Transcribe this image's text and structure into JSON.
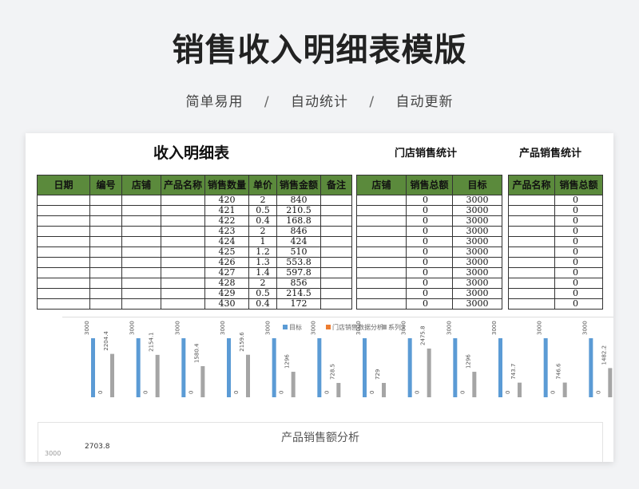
{
  "header": {
    "title": "销售收入明细表模版",
    "subtitle_items": [
      "简单易用",
      "自动统计",
      "自动更新"
    ],
    "separator": "/"
  },
  "sheet": {
    "main_title": "收入明细表",
    "store_title": "门店销售统计",
    "product_title": "产品销售统计",
    "main_table": {
      "headers": [
        "日期",
        "编号",
        "店铺",
        "产品名称",
        "销售数量",
        "单价",
        "销售金额",
        "备注"
      ],
      "rows": [
        [
          "",
          "",
          "",
          "",
          "420",
          "2",
          "840",
          ""
        ],
        [
          "",
          "",
          "",
          "",
          "421",
          "0.5",
          "210.5",
          ""
        ],
        [
          "",
          "",
          "",
          "",
          "422",
          "0.4",
          "168.8",
          ""
        ],
        [
          "",
          "",
          "",
          "",
          "423",
          "2",
          "846",
          ""
        ],
        [
          "",
          "",
          "",
          "",
          "424",
          "1",
          "424",
          ""
        ],
        [
          "",
          "",
          "",
          "",
          "425",
          "1.2",
          "510",
          ""
        ],
        [
          "",
          "",
          "",
          "",
          "426",
          "1.3",
          "553.8",
          ""
        ],
        [
          "",
          "",
          "",
          "",
          "427",
          "1.4",
          "597.8",
          ""
        ],
        [
          "",
          "",
          "",
          "",
          "428",
          "2",
          "856",
          ""
        ],
        [
          "",
          "",
          "",
          "",
          "429",
          "0.5",
          "214.5",
          ""
        ],
        [
          "",
          "",
          "",
          "",
          "430",
          "0.4",
          "172",
          ""
        ]
      ]
    },
    "store_table": {
      "headers": [
        "店铺",
        "销售总额",
        "目标"
      ],
      "rows": [
        [
          "",
          "0",
          "3000"
        ],
        [
          "",
          "0",
          "3000"
        ],
        [
          "",
          "0",
          "3000"
        ],
        [
          "",
          "0",
          "3000"
        ],
        [
          "",
          "0",
          "3000"
        ],
        [
          "",
          "0",
          "3000"
        ],
        [
          "",
          "0",
          "3000"
        ],
        [
          "",
          "0",
          "3000"
        ],
        [
          "",
          "0",
          "3000"
        ],
        [
          "",
          "0",
          "3000"
        ],
        [
          "",
          "0",
          "3000"
        ]
      ]
    },
    "product_table": {
      "headers": [
        "产品名称",
        "销售总额"
      ],
      "rows": [
        [
          "",
          "0"
        ],
        [
          "",
          "0"
        ],
        [
          "",
          "0"
        ],
        [
          "",
          "0"
        ],
        [
          "",
          "0"
        ],
        [
          "",
          "0"
        ],
        [
          "",
          "0"
        ],
        [
          "",
          "0"
        ],
        [
          "",
          "0"
        ],
        [
          "",
          "0"
        ],
        [
          "",
          "0"
        ]
      ]
    }
  },
  "chart_data": [
    {
      "type": "bar",
      "title": "门店销售数据分析",
      "categories": [
        "",
        "",
        "",
        "",
        "",
        "",
        "",
        "",
        "",
        "",
        "",
        ""
      ],
      "series": [
        {
          "name": "目标",
          "color": "#5b9bd5",
          "values": [
            3000,
            3000,
            3000,
            3000,
            3000,
            3000,
            3000,
            3000,
            3000,
            3000,
            3000,
            3000
          ]
        },
        {
          "name": "门店销售数据分析",
          "color": "#ed7d31",
          "values": [
            0,
            0,
            0,
            0,
            0,
            0,
            0,
            0,
            0,
            0,
            0,
            0
          ]
        },
        {
          "name": "系列3",
          "color": "#a5a5a5",
          "values": [
            2204.4,
            2154.1,
            1580.4,
            2159.6,
            1296,
            728.5,
            729,
            2475.8,
            1296,
            743.7,
            746.6,
            1482.2
          ]
        }
      ],
      "labels": {
        "target": [
          "3000",
          "3000",
          "3000",
          "3000",
          "3000",
          "3000",
          "3000",
          "3000",
          "3000",
          "3000",
          "3000",
          "3000"
        ],
        "zero": [
          "0",
          "0",
          "0",
          "0",
          "0",
          "0",
          "0",
          "0",
          "0",
          "0",
          "0",
          "0"
        ],
        "series3": [
          "2204.4",
          "2154.1",
          "1580.4",
          "2159.6",
          "1296",
          "728.5",
          "729",
          "2475.8",
          "1296",
          "743.7",
          "746.6",
          "1482.2"
        ]
      },
      "ylim": [
        0,
        3000
      ],
      "legend": "top"
    },
    {
      "type": "bar",
      "title": "产品销售额分析",
      "visible_value": "2703.8",
      "visible_tick": "3000"
    }
  ]
}
